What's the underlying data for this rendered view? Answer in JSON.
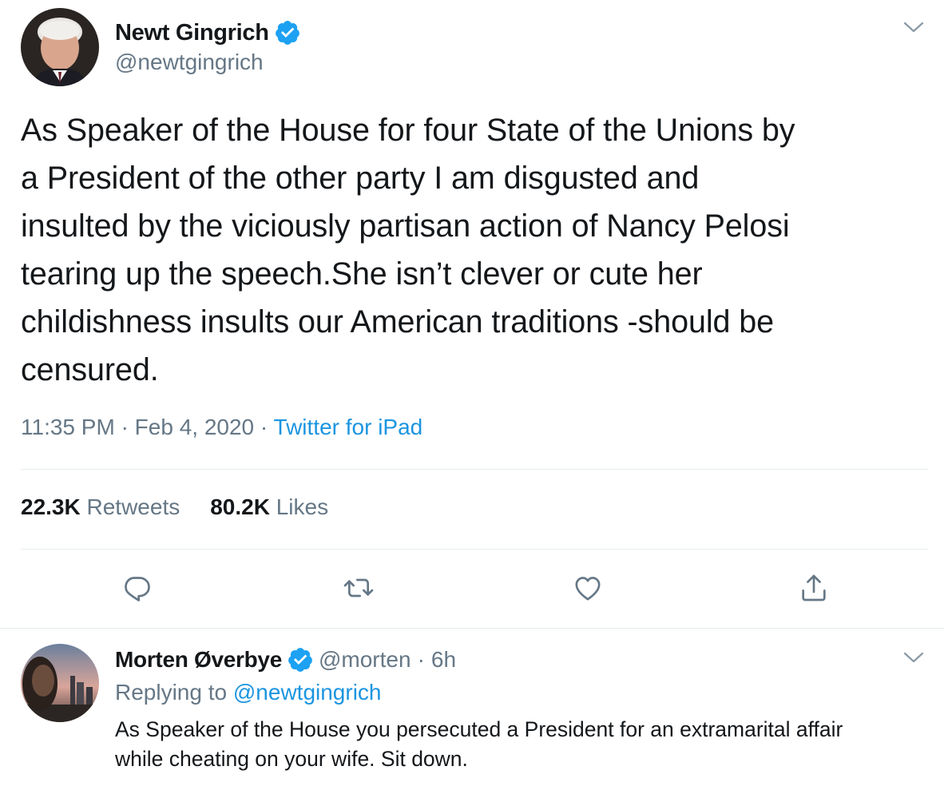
{
  "tweet": {
    "author": {
      "name": "Newt Gingrich",
      "handle": "@newtgingrich",
      "verified": true
    },
    "text_lines": [
      "As Speaker of the House for four State of the Unions by",
      "a President of the other party I am disgusted and",
      "insulted by the viciously partisan action of Nancy Pelosi",
      "tearing up the speech.She isn’t clever or cute her",
      "childishness insults our American traditions -should be",
      "censured."
    ],
    "time": "11:35 PM",
    "date": "Feb 4, 2020",
    "separator": "·",
    "source": "Twitter for iPad",
    "stats": {
      "retweets_count": "22.3K",
      "retweets_label": "Retweets",
      "likes_count": "80.2K",
      "likes_label": "Likes"
    },
    "actions": [
      "reply-icon",
      "retweet-icon",
      "like-icon",
      "share-icon"
    ]
  },
  "reply": {
    "author": {
      "name": "Morten Øverbye",
      "handle": "@morten",
      "verified": true
    },
    "separator": "·",
    "time": "6h",
    "replying_prefix": "Replying to",
    "replying_to": "@newtgingrich",
    "text_lines": [
      "As Speaker of the House you persecuted a President for an extramarital affair",
      "while cheating on your wife. Sit down."
    ]
  },
  "colors": {
    "text": "#14171a",
    "secondary": "#657786",
    "accent": "#1b95e0",
    "divider": "#e6ecf0",
    "verified": "#1da1f2"
  }
}
